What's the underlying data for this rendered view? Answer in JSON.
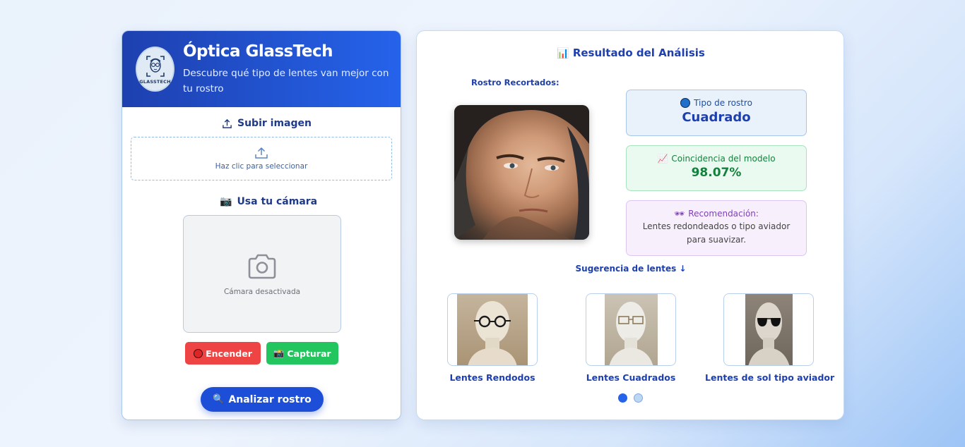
{
  "app": {
    "title": "Óptica GlassTech",
    "subtitle": "Descubre qué tipo de lentes van mejor con tu rostro",
    "logo_text": "GLASSTECH"
  },
  "upload": {
    "title": "Subir imagen",
    "hint": "Haz clic para seleccionar",
    "icon": "upload-icon"
  },
  "camera": {
    "title": "Usa tu cámara",
    "status": "Cámara desactivada",
    "on_label": "Encender",
    "capture_label": "Capturar"
  },
  "analyze": {
    "label": "Analizar rostro"
  },
  "result": {
    "title": "Resultado del Análisis",
    "face_label": "Rostro Recortados:",
    "face_type_label": "Tipo de rostro",
    "face_type_value": "Cuadrado",
    "match_label": "Coincidencia del modelo",
    "match_value": "98.07%",
    "rec_label": "Recomendación:",
    "rec_text": "Lentes redondeados o tipo aviador para suavizar."
  },
  "suggestions": {
    "title": "Sugerencia de lentes ↓",
    "items": [
      {
        "label": "Lentes Rendodos"
      },
      {
        "label": "Lentes Cuadrados"
      },
      {
        "label": "Lentes de sol tipo aviador"
      }
    ],
    "page": 1,
    "pages": 2
  },
  "colors": {
    "primary": "#1e40af",
    "accent": "#2563eb",
    "danger": "#ef4444",
    "success": "#22c55e"
  }
}
